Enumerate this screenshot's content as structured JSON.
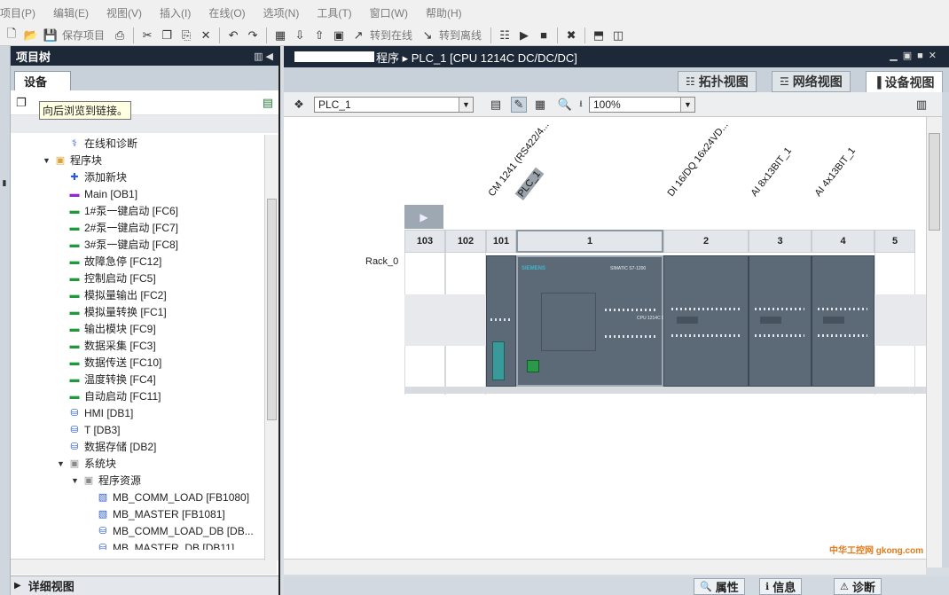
{
  "menu": [
    "项目(P)",
    "编辑(E)",
    "视图(V)",
    "插入(I)",
    "在线(O)",
    "选项(N)",
    "工具(T)",
    "窗口(W)",
    "帮助(H)"
  ],
  "toolbar": {
    "save_project": "保存项目",
    "go_online": "转到在线",
    "go_offline": "转到离线"
  },
  "left_panel": {
    "title": "项目树",
    "tab": "设备",
    "tooltip": "向后浏览到链接。",
    "details_view": "详细视图"
  },
  "tree": [
    {
      "label": "在线和诊断",
      "icon": "diagnostics-icon",
      "indent": 1,
      "arrow": ""
    },
    {
      "label": "程序块",
      "icon": "folder-icon",
      "indent": 0,
      "arrow": "▼"
    },
    {
      "label": "添加新块",
      "icon": "add-block-icon",
      "indent": 1,
      "arrow": ""
    },
    {
      "label": "Main [OB1]",
      "icon": "ob-block-icon",
      "indent": 1,
      "arrow": ""
    },
    {
      "label": "1#泵一键启动 [FC6]",
      "icon": "fc-block-icon",
      "indent": 1,
      "arrow": ""
    },
    {
      "label": "2#泵一键启动 [FC7]",
      "icon": "fc-block-icon",
      "indent": 1,
      "arrow": ""
    },
    {
      "label": "3#泵一键启动 [FC8]",
      "icon": "fc-block-icon",
      "indent": 1,
      "arrow": ""
    },
    {
      "label": "故障急停 [FC12]",
      "icon": "fc-block-icon",
      "indent": 1,
      "arrow": ""
    },
    {
      "label": "控制启动 [FC5]",
      "icon": "fc-block-icon",
      "indent": 1,
      "arrow": ""
    },
    {
      "label": "模拟量输出 [FC2]",
      "icon": "fc-block-icon",
      "indent": 1,
      "arrow": ""
    },
    {
      "label": "模拟量转换 [FC1]",
      "icon": "fc-block-icon",
      "indent": 1,
      "arrow": ""
    },
    {
      "label": "输出模块 [FC9]",
      "icon": "fc-block-icon",
      "indent": 1,
      "arrow": ""
    },
    {
      "label": "数据采集 [FC3]",
      "icon": "fc-block-icon",
      "indent": 1,
      "arrow": ""
    },
    {
      "label": "数据传送 [FC10]",
      "icon": "fc-block-icon",
      "indent": 1,
      "arrow": ""
    },
    {
      "label": "温度转换 [FC4]",
      "icon": "fc-block-icon",
      "indent": 1,
      "arrow": ""
    },
    {
      "label": "自动启动 [FC11]",
      "icon": "fc-block-icon",
      "indent": 1,
      "arrow": ""
    },
    {
      "label": "HMI [DB1]",
      "icon": "db-block-icon",
      "indent": 1,
      "arrow": ""
    },
    {
      "label": "T [DB3]",
      "icon": "db-block-icon",
      "indent": 1,
      "arrow": ""
    },
    {
      "label": "数据存储 [DB2]",
      "icon": "db-block-icon",
      "indent": 1,
      "arrow": ""
    },
    {
      "label": "系统块",
      "icon": "system-folder-icon",
      "indent": 1,
      "arrow": "▼"
    },
    {
      "label": "程序资源",
      "icon": "system-folder-icon",
      "indent": 2,
      "arrow": "▼"
    },
    {
      "label": "MB_COMM_LOAD [FB1080]",
      "icon": "fb-block-icon",
      "indent": 3,
      "arrow": ""
    },
    {
      "label": "MB_MASTER [FB1081]",
      "icon": "fb-block-icon",
      "indent": 3,
      "arrow": ""
    },
    {
      "label": "MB_COMM_LOAD_DB [DB...",
      "icon": "db-block-icon",
      "indent": 3,
      "arrow": ""
    },
    {
      "label": "MB_MASTER_DB [DB11]",
      "icon": "db-block-icon",
      "indent": 3,
      "arrow": ""
    }
  ],
  "main": {
    "title_suffix": "程序  ▸  PLC_1 [CPU 1214C DC/DC/DC]",
    "tabs": [
      "拓扑视图",
      "网络视图",
      "设备视图"
    ],
    "device_select": "PLC_1",
    "zoom": "100%",
    "rack_label": "Rack_0",
    "slots": [
      "103",
      "102",
      "101",
      "1",
      "2",
      "3",
      "4",
      "5"
    ],
    "module_labels": [
      "CM 1241 (RS422/4...",
      "PLC_1",
      "DI 16/DQ 16x24VD...",
      "AI 8x13BIT_1",
      "AI 4x13BIT_1"
    ],
    "brand": "SIEMENS",
    "cpu_tiny": "SIMATIC S7-1200",
    "cpu_model": "CPU 1214C DC/DC/DC"
  },
  "bottom_tabs": [
    "属性",
    "信息",
    "诊断"
  ],
  "watermark": "中华工控网 gkong.com",
  "colors": {
    "header_dark": "#1d2938",
    "module_body": "#5c6a77",
    "fc_green": "#1e9a3a"
  }
}
